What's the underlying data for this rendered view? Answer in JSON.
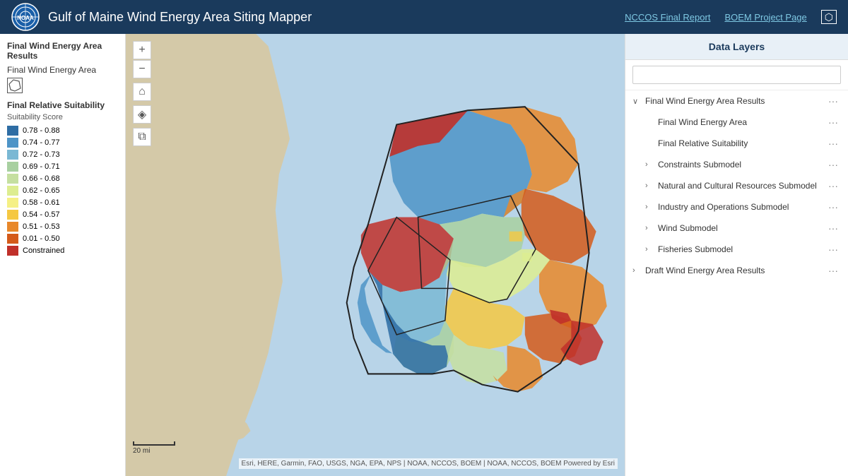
{
  "header": {
    "title": "Gulf of Maine Wind Energy Area Siting Mapper",
    "nccos_link": "NCCOS Final Report",
    "boem_link": "BOEM Project Page",
    "logo_alt": "NOAA logo"
  },
  "left_panel": {
    "section_title": "Final Wind Energy Area Results",
    "wind_area_label": "Final Wind Energy Area",
    "suitability_title": "Final Relative Suitability",
    "suitability_subtitle": "Suitability Score",
    "legend_items": [
      {
        "range": "0.78 - 0.88",
        "color": "#2e6da4"
      },
      {
        "range": "0.74 - 0.77",
        "color": "#4d94c7"
      },
      {
        "range": "0.72 - 0.73",
        "color": "#7ab8d4"
      },
      {
        "range": "0.69 - 0.71",
        "color": "#a8d0a0"
      },
      {
        "range": "0.66 - 0.68",
        "color": "#c5dfa0"
      },
      {
        "range": "0.62 - 0.65",
        "color": "#dded90"
      },
      {
        "range": "0.58 - 0.61",
        "color": "#f5f085"
      },
      {
        "range": "0.54 - 0.57",
        "color": "#f5c842"
      },
      {
        "range": "0.51 - 0.53",
        "color": "#e8882a"
      },
      {
        "range": "0.01 - 0.50",
        "color": "#d45a1a"
      },
      {
        "range": "Constrained",
        "color": "#c0302a"
      }
    ]
  },
  "right_panel": {
    "title": "Data Layers",
    "search_placeholder": "",
    "layers": [
      {
        "id": "final-wind-energy-results",
        "label": "Final Wind Energy Area Results",
        "level": 0,
        "expandable": true,
        "expanded": true
      },
      {
        "id": "final-wind-energy-area",
        "label": "Final Wind Energy Area",
        "level": 1,
        "expandable": false
      },
      {
        "id": "final-relative-suitability",
        "label": "Final Relative Suitability",
        "level": 1,
        "expandable": false
      },
      {
        "id": "constraints-submodel",
        "label": "Constraints Submodel",
        "level": 1,
        "expandable": true,
        "expanded": false
      },
      {
        "id": "natural-cultural",
        "label": "Natural and Cultural Resources Submodel",
        "level": 1,
        "expandable": true,
        "expanded": false
      },
      {
        "id": "industry-operations",
        "label": "Industry and Operations Submodel",
        "level": 1,
        "expandable": true,
        "expanded": false
      },
      {
        "id": "wind-submodel",
        "label": "Wind Submodel",
        "level": 1,
        "expandable": true,
        "expanded": false
      },
      {
        "id": "fisheries-submodel",
        "label": "Fisheries Submodel",
        "level": 1,
        "expandable": true,
        "expanded": false
      },
      {
        "id": "draft-wind-energy",
        "label": "Draft Wind Energy Area Results",
        "level": 0,
        "expandable": true,
        "expanded": false
      }
    ]
  },
  "map": {
    "attribution": "Esri, HERE, Garmin, FAO, USGS, NGA, EPA, NPS | NOAA, NCCOS, BOEM | NOAA, NCCOS, BOEM  Powered by Esri",
    "scale_label": "20 mi"
  },
  "icons": {
    "plus": "+",
    "minus": "−",
    "home": "⌂",
    "compass": "◈",
    "expand": "⧉",
    "search": "🔍",
    "external": "↗",
    "ellipsis": "···",
    "chevron_right": "›",
    "chevron_down": "∨"
  }
}
